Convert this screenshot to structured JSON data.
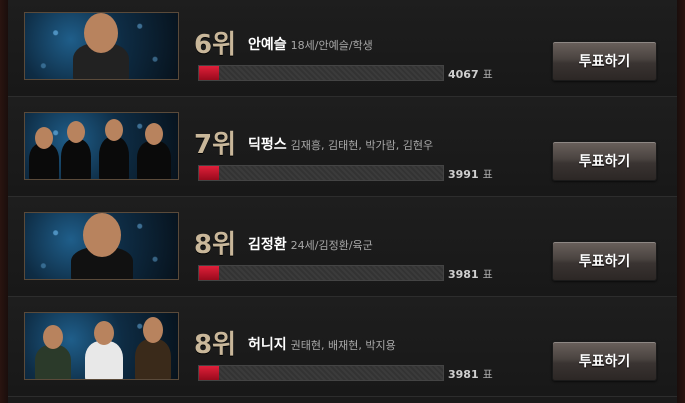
{
  "vote_label": "투표하기",
  "vote_unit": "표",
  "rows": [
    {
      "rank": "6위",
      "name": "안예슬",
      "meta": "18세/안예슬/학생",
      "votes": "4067",
      "progress": 0.08
    },
    {
      "rank": "7위",
      "name": "딕펑스",
      "meta": "김재흥, 김태현, 박가람, 김현우",
      "votes": "3991",
      "progress": 0.08
    },
    {
      "rank": "8위",
      "name": "김정환",
      "meta": "24세/김정환/육군",
      "votes": "3981",
      "progress": 0.08
    },
    {
      "rank": "8위",
      "name": "허니지",
      "meta": "권태현, 배재현, 박지용",
      "votes": "3981",
      "progress": 0.08
    }
  ],
  "colors": {
    "bar_fill": "#c0142c",
    "rank": "#c9b79a"
  }
}
